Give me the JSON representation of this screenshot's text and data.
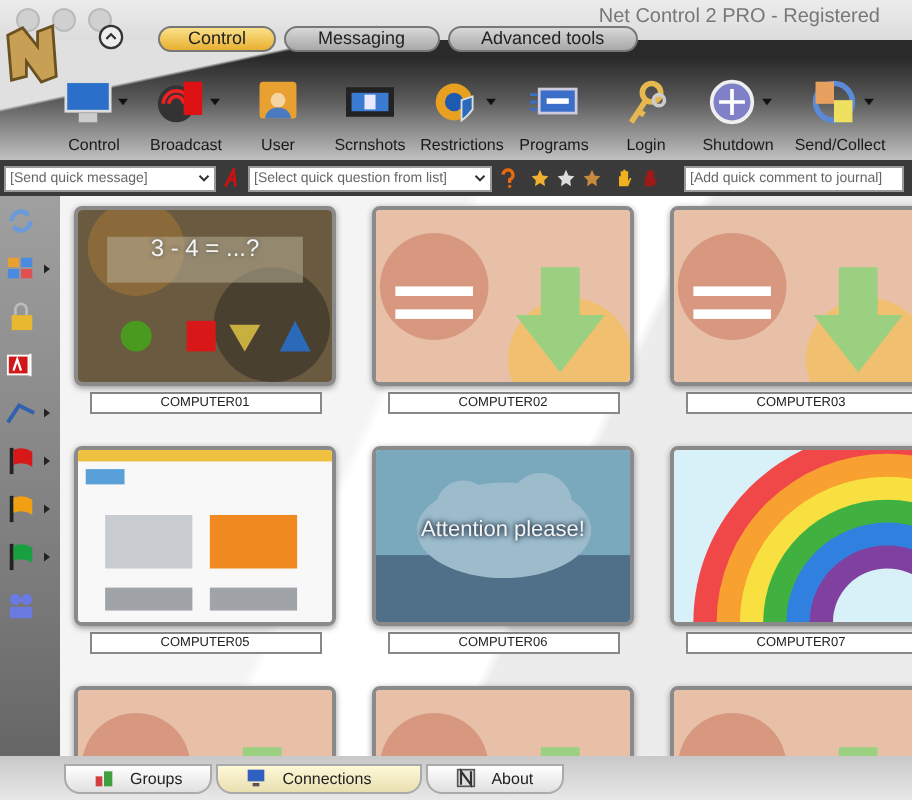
{
  "window": {
    "title": "Net Control 2 PRO - Registered"
  },
  "tabs": [
    {
      "label": "Control",
      "selected": true
    },
    {
      "label": "Messaging",
      "selected": false
    },
    {
      "label": "Advanced tools",
      "selected": false
    }
  ],
  "toolbar": [
    {
      "label": "Control",
      "menu": true
    },
    {
      "label": "Broadcast",
      "menu": true
    },
    {
      "label": "User",
      "menu": false
    },
    {
      "label": "Scrnshots",
      "menu": false
    },
    {
      "label": "Restrictions",
      "menu": true
    },
    {
      "label": "Programs",
      "menu": false
    },
    {
      "label": "Login",
      "menu": false
    },
    {
      "label": "Shutdown",
      "menu": true
    },
    {
      "label": "Send/Collect",
      "menu": true
    }
  ],
  "quick_bar": {
    "message": {
      "placeholder": "[Send quick message]"
    },
    "question": {
      "placeholder": "[Select quick question from list]"
    },
    "journal": {
      "placeholder": "[Add quick comment to journal]"
    }
  },
  "sidebar": [
    {
      "menu": false
    },
    {
      "menu": true
    },
    {
      "menu": false
    },
    {
      "menu": false
    },
    {
      "menu": true
    },
    {
      "menu": true,
      "color": "#d81818"
    },
    {
      "menu": true,
      "color": "#f0a010"
    },
    {
      "menu": true,
      "color": "#18a040"
    },
    {
      "menu": false
    }
  ],
  "computers": [
    {
      "kind": "picture",
      "name": "COMPUTER01",
      "caption": "3 - 4 = ...?"
    },
    {
      "kind": "picture",
      "name": "COMPUTER02"
    },
    {
      "kind": "picture",
      "name": "COMPUTER03"
    },
    {
      "kind": "picture",
      "name": "COMPUTER05"
    },
    {
      "kind": "picture",
      "name": "COMPUTER06",
      "caption": "Attention please!"
    },
    {
      "kind": "picture",
      "name": "COMPUTER07"
    },
    {
      "kind": "picture"
    },
    {
      "kind": "picture"
    },
    {
      "kind": "picture"
    }
  ],
  "bottom_tabs": [
    {
      "label": "Groups",
      "selected": false
    },
    {
      "label": "Connections",
      "selected": true
    },
    {
      "label": "About",
      "selected": false
    }
  ]
}
